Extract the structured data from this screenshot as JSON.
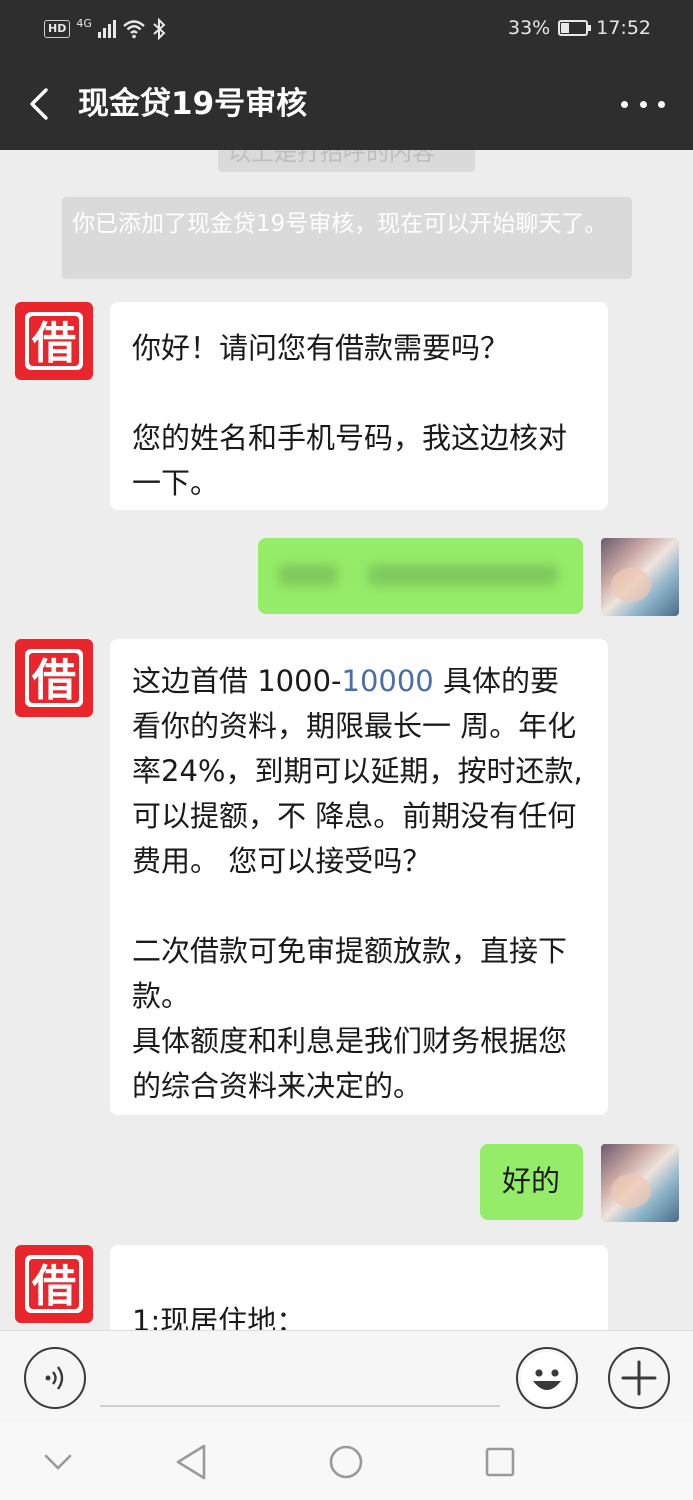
{
  "status_bar": {
    "hd": "HD",
    "network": "4G",
    "battery": "33%",
    "time": "17:52"
  },
  "header": {
    "title": "现金贷19号审核"
  },
  "chat": {
    "system_top": "以上是打招呼的内容",
    "system_added": "你已添加了现金贷19号审核，现在可以开始聊天了。",
    "contact_avatar_char": "借",
    "messages": [
      {
        "side": "in",
        "text": "你好！请问您有借款需要吗？\n\n您的姓名和手机号码，我这边核对一下。"
      },
      {
        "side": "out",
        "text": ""
      },
      {
        "side": "in",
        "text_before": "这边首借 1000-",
        "text_link": "10000",
        "text_after": " 具体的要看你的资料，期限最长一 周。年化率24%，到期可以延期，按时还款,可以提额，不 降息。前期没有任何费用。 您可以接受吗？\n\n二次借款可免审提额放款，直接下款。\n具体额度和利息是我们财务根据您的综合资料来决定的。"
      },
      {
        "side": "out",
        "text": "好的"
      },
      {
        "side": "in",
        "text": "1:现居住地："
      }
    ]
  },
  "input_bar": {
    "voice": "voice-icon",
    "emoji": "emoji-icon",
    "plus": "plus-icon"
  },
  "nav_bar": {
    "buttons": [
      "down-icon",
      "back-triangle-icon",
      "home-circle-icon",
      "recents-square-icon"
    ]
  }
}
